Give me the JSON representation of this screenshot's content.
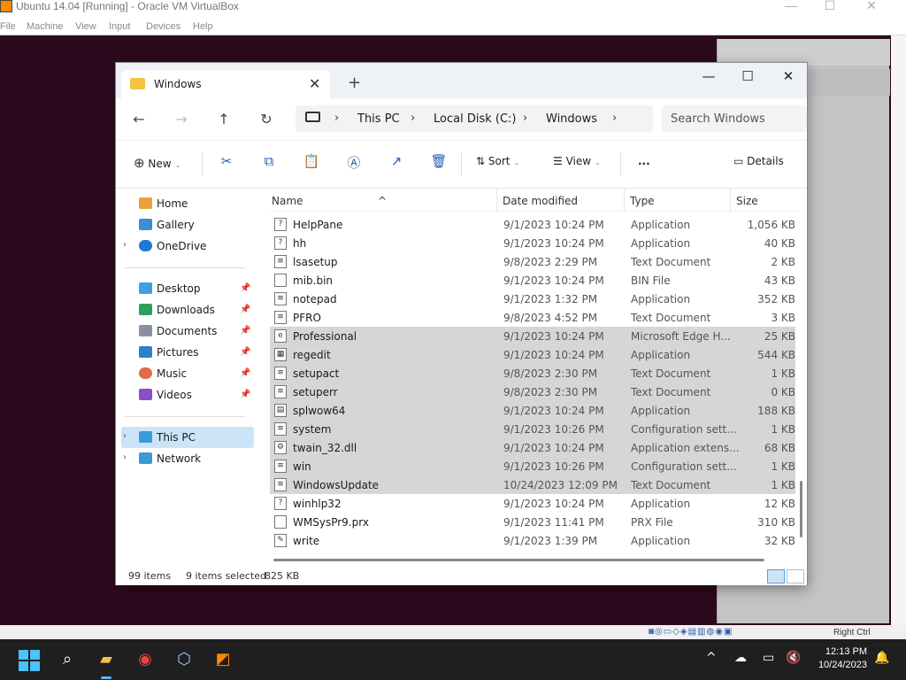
{
  "vbox": {
    "title": "Ubuntu 14.04 [Running] - Oracle VM VirtualBox",
    "menu": [
      "File",
      "Machine",
      "View",
      "Input",
      "Devices",
      "Help"
    ],
    "status_right": "Right Ctrl"
  },
  "explorer": {
    "tab_title": "Windows",
    "breadcrumbs": [
      "This PC",
      "Local Disk (C:)",
      "Windows"
    ],
    "search_placeholder": "Search Windows",
    "toolbar": {
      "new": "New",
      "sort": "Sort",
      "view": "View",
      "details": "Details",
      "more": "..."
    },
    "sidebar": {
      "top": [
        {
          "label": "Home",
          "color": "#e9a13b"
        },
        {
          "label": "Gallery",
          "color": "#3a8fd6"
        },
        {
          "label": "OneDrive",
          "color": "#1e78d7"
        }
      ],
      "pinned": [
        {
          "label": "Desktop",
          "color": "#3da3e0"
        },
        {
          "label": "Downloads",
          "color": "#2e9e5b"
        },
        {
          "label": "Documents",
          "color": "#8a8fa3"
        },
        {
          "label": "Pictures",
          "color": "#2f7fd0"
        },
        {
          "label": "Music",
          "color": "#e06a4a"
        },
        {
          "label": "Videos",
          "color": "#8a4fc7"
        }
      ],
      "bottom": [
        {
          "label": "This PC",
          "color": "#3a9bd6"
        },
        {
          "label": "Network",
          "color": "#3a9bd6"
        }
      ]
    },
    "columns": {
      "name": "Name",
      "date": "Date modified",
      "type": "Type",
      "size": "Size"
    },
    "files": [
      {
        "name": "HelpPane",
        "date": "9/1/2023 10:24 PM",
        "type": "Application",
        "size": "1,056 KB",
        "selected": false,
        "icon": "?"
      },
      {
        "name": "hh",
        "date": "9/1/2023 10:24 PM",
        "type": "Application",
        "size": "40 KB",
        "selected": false,
        "icon": "?"
      },
      {
        "name": "lsasetup",
        "date": "9/8/2023 2:29 PM",
        "type": "Text Document",
        "size": "2 KB",
        "selected": false,
        "icon": "≡"
      },
      {
        "name": "mib.bin",
        "date": "9/1/2023 10:24 PM",
        "type": "BIN File",
        "size": "43 KB",
        "selected": false,
        "icon": ""
      },
      {
        "name": "notepad",
        "date": "9/1/2023 1:32 PM",
        "type": "Application",
        "size": "352 KB",
        "selected": false,
        "icon": "≡"
      },
      {
        "name": "PFRO",
        "date": "9/8/2023 4:52 PM",
        "type": "Text Document",
        "size": "3 KB",
        "selected": false,
        "icon": "≡"
      },
      {
        "name": "Professional",
        "date": "9/1/2023 10:24 PM",
        "type": "Microsoft Edge H...",
        "size": "25 KB",
        "selected": true,
        "icon": "e"
      },
      {
        "name": "regedit",
        "date": "9/1/2023 10:24 PM",
        "type": "Application",
        "size": "544 KB",
        "selected": true,
        "icon": "▦"
      },
      {
        "name": "setupact",
        "date": "9/8/2023 2:30 PM",
        "type": "Text Document",
        "size": "1 KB",
        "selected": true,
        "icon": "≡"
      },
      {
        "name": "setuperr",
        "date": "9/8/2023 2:30 PM",
        "type": "Text Document",
        "size": "0 KB",
        "selected": true,
        "icon": "≡"
      },
      {
        "name": "splwow64",
        "date": "9/1/2023 10:24 PM",
        "type": "Application",
        "size": "188 KB",
        "selected": true,
        "icon": "▤"
      },
      {
        "name": "system",
        "date": "9/1/2023 10:26 PM",
        "type": "Configuration sett...",
        "size": "1 KB",
        "selected": true,
        "icon": "≡"
      },
      {
        "name": "twain_32.dll",
        "date": "9/1/2023 10:24 PM",
        "type": "Application extens...",
        "size": "68 KB",
        "selected": true,
        "icon": "⚙"
      },
      {
        "name": "win",
        "date": "9/1/2023 10:26 PM",
        "type": "Configuration sett...",
        "size": "1 KB",
        "selected": true,
        "icon": "≡"
      },
      {
        "name": "WindowsUpdate",
        "date": "10/24/2023 12:09 PM",
        "type": "Text Document",
        "size": "1 KB",
        "selected": true,
        "icon": "≡"
      },
      {
        "name": "winhlp32",
        "date": "9/1/2023 10:24 PM",
        "type": "Application",
        "size": "12 KB",
        "selected": false,
        "icon": "?"
      },
      {
        "name": "WMSysPr9.prx",
        "date": "9/1/2023 11:41 PM",
        "type": "PRX File",
        "size": "310 KB",
        "selected": false,
        "icon": ""
      },
      {
        "name": "write",
        "date": "9/1/2023 1:39 PM",
        "type": "Application",
        "size": "32 KB",
        "selected": false,
        "icon": "✎"
      }
    ],
    "status": {
      "items": "99 items",
      "selected": "9 items selected",
      "size": "825 KB"
    }
  },
  "taskbar": {
    "time": "12:13 PM",
    "date": "10/24/2023"
  }
}
